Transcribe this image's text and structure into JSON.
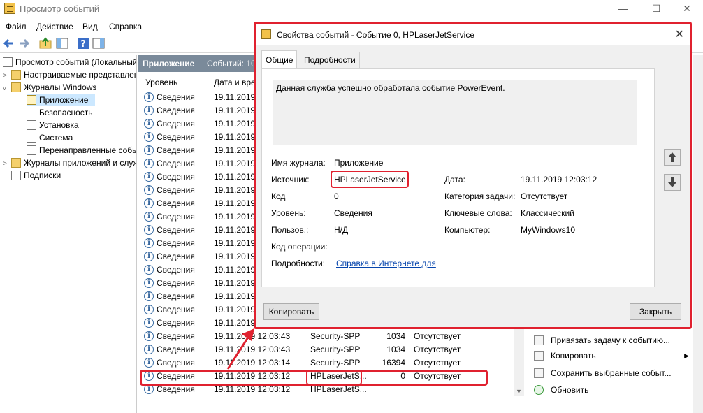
{
  "window": {
    "title": "Просмотр событий",
    "minimize": "—",
    "maximize": "☐",
    "close": "✕"
  },
  "menu": [
    "Файл",
    "Действие",
    "Вид",
    "Справка"
  ],
  "tree": {
    "root": "Просмотр событий (Локальный)",
    "custom_views": "Настраиваемые представления",
    "windows_logs": "Журналы Windows",
    "logs": [
      "Приложение",
      "Безопасность",
      "Установка",
      "Система",
      "Перенаправленные события"
    ],
    "app_logs": "Журналы приложений и служб",
    "subscriptions": "Подписки"
  },
  "list": {
    "title": "Приложение",
    "count": "Событий: 10",
    "columns": [
      "Уровень",
      "Дата и время"
    ],
    "rows": [
      {
        "level": "Сведения",
        "datetime": "19.11.2019",
        "source": "",
        "code": "",
        "category": ""
      },
      {
        "level": "Сведения",
        "datetime": "19.11.2019",
        "source": "",
        "code": "",
        "category": ""
      },
      {
        "level": "Сведения",
        "datetime": "19.11.2019",
        "source": "",
        "code": "",
        "category": ""
      },
      {
        "level": "Сведения",
        "datetime": "19.11.2019",
        "source": "",
        "code": "",
        "category": ""
      },
      {
        "level": "Сведения",
        "datetime": "19.11.2019",
        "source": "",
        "code": "",
        "category": ""
      },
      {
        "level": "Сведения",
        "datetime": "19.11.2019",
        "source": "",
        "code": "",
        "category": ""
      },
      {
        "level": "Сведения",
        "datetime": "19.11.2019",
        "source": "",
        "code": "",
        "category": ""
      },
      {
        "level": "Сведения",
        "datetime": "19.11.2019",
        "source": "",
        "code": "",
        "category": ""
      },
      {
        "level": "Сведения",
        "datetime": "19.11.2019",
        "source": "",
        "code": "",
        "category": ""
      },
      {
        "level": "Сведения",
        "datetime": "19.11.2019",
        "source": "",
        "code": "",
        "category": ""
      },
      {
        "level": "Сведения",
        "datetime": "19.11.2019",
        "source": "",
        "code": "",
        "category": ""
      },
      {
        "level": "Сведения",
        "datetime": "19.11.2019",
        "source": "",
        "code": "",
        "category": ""
      },
      {
        "level": "Сведения",
        "datetime": "19.11.2019",
        "source": "",
        "code": "",
        "category": ""
      },
      {
        "level": "Сведения",
        "datetime": "19.11.2019",
        "source": "",
        "code": "",
        "category": ""
      },
      {
        "level": "Сведения",
        "datetime": "19.11.2019",
        "source": "",
        "code": "",
        "category": ""
      },
      {
        "level": "Сведения",
        "datetime": "19.11.2019",
        "source": "",
        "code": "",
        "category": ""
      },
      {
        "level": "Сведения",
        "datetime": "19.11.2019",
        "source": "",
        "code": "",
        "category": ""
      },
      {
        "level": "Сведения",
        "datetime": "19.11.2019",
        "source": "",
        "code": "",
        "category": ""
      },
      {
        "level": "Сведения",
        "datetime": "19.11.2019 12:03:43",
        "source": "Security-SPP",
        "code": "1034",
        "category": "Отсутствует"
      },
      {
        "level": "Сведения",
        "datetime": "19.11.2019 12:03:43",
        "source": "Security-SPP",
        "code": "1034",
        "category": "Отсутствует"
      },
      {
        "level": "Сведения",
        "datetime": "19.11.2019 12:03:14",
        "source": "Security-SPP",
        "code": "16394",
        "category": "Отсутствует"
      },
      {
        "level": "Сведения",
        "datetime": "19.11.2019 12:03:12",
        "source": "HPLaserJetS...",
        "code": "0",
        "category": "Отсутствует"
      },
      {
        "level": "Сведения",
        "datetime": "19.11.2019 12:03:12",
        "source": "HPLaserJetS...",
        "code": "",
        "category": ""
      }
    ]
  },
  "actions": [
    {
      "icon": "task-icon",
      "label": "Привязать задачу к событию..."
    },
    {
      "icon": "copy-icon",
      "label": "Копировать",
      "submenu": "▶"
    },
    {
      "icon": "save-icon",
      "label": "Сохранить выбранные событ..."
    },
    {
      "icon": "refresh-icon",
      "label": "Обновить"
    }
  ],
  "dialog": {
    "title": "Свойства событий - Событие 0, HPLaserJetService",
    "tabs": [
      "Общие",
      "Подробности"
    ],
    "message": "Данная служба успешно обработала событие PowerEvent.",
    "fields": {
      "log_name_label": "Имя журнала:",
      "log_name": "Приложение",
      "source_label": "Источник:",
      "source": "HPLaserJetService",
      "date_label": "Дата:",
      "date": "19.11.2019 12:03:12",
      "code_label": "Код",
      "code": "0",
      "task_category_label": "Категория задачи:",
      "task_category": "Отсутствует",
      "level_label": "Уровень:",
      "level": "Сведения",
      "keywords_label": "Ключевые слова:",
      "keywords": "Классический",
      "user_label": "Пользов.:",
      "user": "Н/Д",
      "computer_label": "Компьютер:",
      "computer": "MyWindows10",
      "opcode_label": "Код операции:",
      "opcode": "",
      "more_label": "Подробности:",
      "more_link": "Справка в Интернете для "
    },
    "copy_button": "Копировать",
    "close_button": "Закрыть",
    "up": "🡅",
    "down": "🡇"
  },
  "colors": {
    "highlight": "#e0212f",
    "selection": "#cce8ff",
    "list_header": "#7a8a9a",
    "link": "#0645ad"
  }
}
